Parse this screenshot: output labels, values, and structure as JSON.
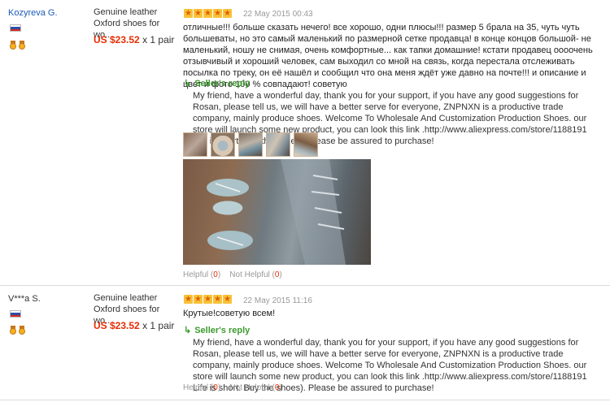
{
  "reviews": [
    {
      "buyer": "Kozyreva G.",
      "product": "Genuine leather Oxford shoes for wo...",
      "price": "US $23.52",
      "quantity": "x 1 pair",
      "rating": 5,
      "date": "22 May 2015 00:43",
      "feedback": "отличные!!! больше сказать нечего! все хорошо, одни плюсы!!! размер 5 брала на 35, чуть чуть большеваты, но это самый маленький по размерной сетке продавца! в конце концов большой- не маленький, ношу не снимая, очень комфортные... как тапки домашние! кстати продавец оооочень отзывчивый и хороший человек, сам выходил со мной на связь, когда перестала отслеживать посылка по треку, он её нашёл и сообщил что она меня ждёт уже давно на почте!!! и описание и цвет и фото 100 % совпадают! советую",
      "seller_reply_label": "Seller's reply",
      "seller_reply": "My friend, have a wonderful day, thank you for your support, if you have any good suggestions for Rosan, please tell us, we will have a better serve for everyone, ZNPNXN is a productive trade company, mainly produce shoes. Welcome To Wholesale And Customization Production Shoes. our store will launch some new product, you can look this link .http://www.aliexpress.com/store/1188191 Life is short. Buy the shoes). Please be assured to purchase!",
      "helpful_label": "Helpful",
      "helpful_count": "0",
      "not_helpful_label": "Not Helpful",
      "not_helpful_count": "0",
      "thumbnail_count": 5
    },
    {
      "buyer": "V***a S.",
      "product": "Genuine leather Oxford shoes for wo...",
      "price": "US $23.52",
      "quantity": "x 1 pair",
      "rating": 5,
      "date": "22 May 2015 11:16",
      "feedback": "Крутые!советую всем!",
      "seller_reply_label": "Seller's reply",
      "seller_reply": "My friend, have a wonderful day, thank you for your support, if you have any good suggestions for Rosan, please tell us, we will have a better serve for everyone, ZNPNXN is a productive trade company, mainly produce shoes. Welcome To Wholesale And Customization Production Shoes. our store will launch some new product, you can look this link .http://www.aliexpress.com/store/1188191 Life is short. Buy the shoes). Please be assured to purchase!",
      "helpful_label": "Helpful",
      "helpful_count": "0",
      "not_helpful_label": "Not Helpful",
      "not_helpful_count": "0"
    }
  ],
  "icons": {
    "star": "star-icon",
    "flag": "russia-flag-icon",
    "medal": "medal-icon",
    "reply_arrow": "reply-arrow-icon"
  },
  "colors": {
    "price": "#e62e04",
    "seller_reply": "#3c9a2e",
    "buyer_link": "#1a5bb5",
    "star": "#f08200"
  }
}
